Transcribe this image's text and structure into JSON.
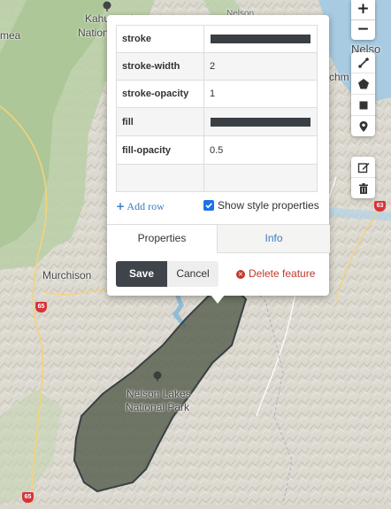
{
  "map": {
    "labels": {
      "kahurangi": "Kahurangi",
      "kahurangi2": "National",
      "mea": "mea",
      "nelson": "Nelso",
      "nelson_top": "Nelson",
      "chm": "chm",
      "murchison": "Murchison",
      "nelson_lakes": "Nelson Lakes",
      "national_park": "National Park"
    },
    "route_badges": [
      "65",
      "65",
      "63"
    ],
    "polygon_color": "#5a6352"
  },
  "zoom": {
    "in_label": "+",
    "out_label": "−"
  },
  "draw_tools": [
    "polyline-icon",
    "polygon-icon",
    "rectangle-icon",
    "marker-icon"
  ],
  "edit_tools": [
    "edit-icon",
    "trash-icon"
  ],
  "popup": {
    "rows": [
      {
        "key": "stroke",
        "value": "",
        "swatch": "#3a3f44"
      },
      {
        "key": "stroke-width",
        "value": "2"
      },
      {
        "key": "stroke-opacity",
        "value": "1"
      },
      {
        "key": "fill",
        "value": "",
        "swatch": "#3a3f44"
      },
      {
        "key": "fill-opacity",
        "value": "0.5"
      },
      {
        "key": "",
        "value": ""
      }
    ],
    "add_row": "Add row",
    "show_style": "Show style properties",
    "show_style_checked": true,
    "tabs": {
      "properties": "Properties",
      "info": "Info"
    },
    "save": "Save",
    "cancel": "Cancel",
    "delete": "Delete feature"
  }
}
